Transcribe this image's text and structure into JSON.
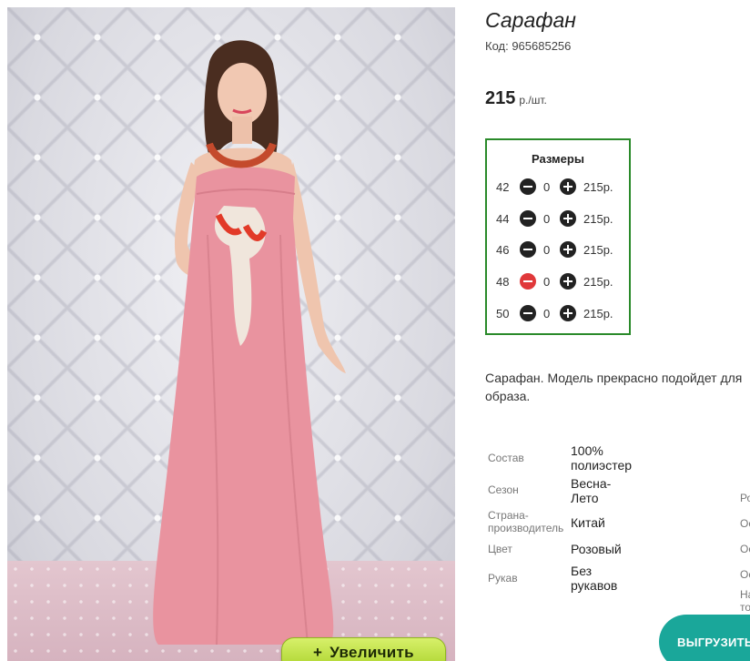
{
  "product": {
    "title": "Сарафан",
    "code": "Код: 965685256",
    "price": "215",
    "price_unit": "р./шт."
  },
  "sizes": {
    "title": "Размеры",
    "rows": [
      {
        "size": "42",
        "qty": "0",
        "price": "215р."
      },
      {
        "size": "44",
        "qty": "0",
        "price": "215р."
      },
      {
        "size": "46",
        "qty": "0",
        "price": "215р."
      },
      {
        "size": "48",
        "qty": "0",
        "price": "215р."
      },
      {
        "size": "50",
        "qty": "0",
        "price": "215р."
      }
    ]
  },
  "description": {
    "line1": "Сарафан. Модель прекрасно подойдет для",
    "line2": "образа."
  },
  "specs": [
    {
      "label": "Состав",
      "value_line1": "100%",
      "value_line2": "полиэстер"
    },
    {
      "label": "Сезон",
      "value_line1": "Весна-",
      "value_line2": "Лето"
    },
    {
      "label_line1": "Страна-",
      "label_line2": "производитель",
      "value_line1": "Китай"
    },
    {
      "label": "Цвет",
      "value_line1": "Розовый"
    },
    {
      "label": "Рукав",
      "value_line1": "Без",
      "value_line2": "рукавов"
    }
  ],
  "right_cut": [
    "Ро",
    "Ос",
    "Ос",
    "Ос",
    "На",
    "то"
  ],
  "buttons": {
    "zoom_label": "Увеличить",
    "zoom_plus": "+",
    "export_label": "ВЫГРУЗИТЬ"
  },
  "colors": {
    "sizes_border": "#2a8a2a",
    "zoom_button": "#b5da35",
    "export_button": "#1aa79a",
    "minus_active": "#e0383a",
    "dress": "#e9939f"
  },
  "icons": {
    "minus": "minus-circle-icon",
    "plus": "plus-circle-icon"
  }
}
